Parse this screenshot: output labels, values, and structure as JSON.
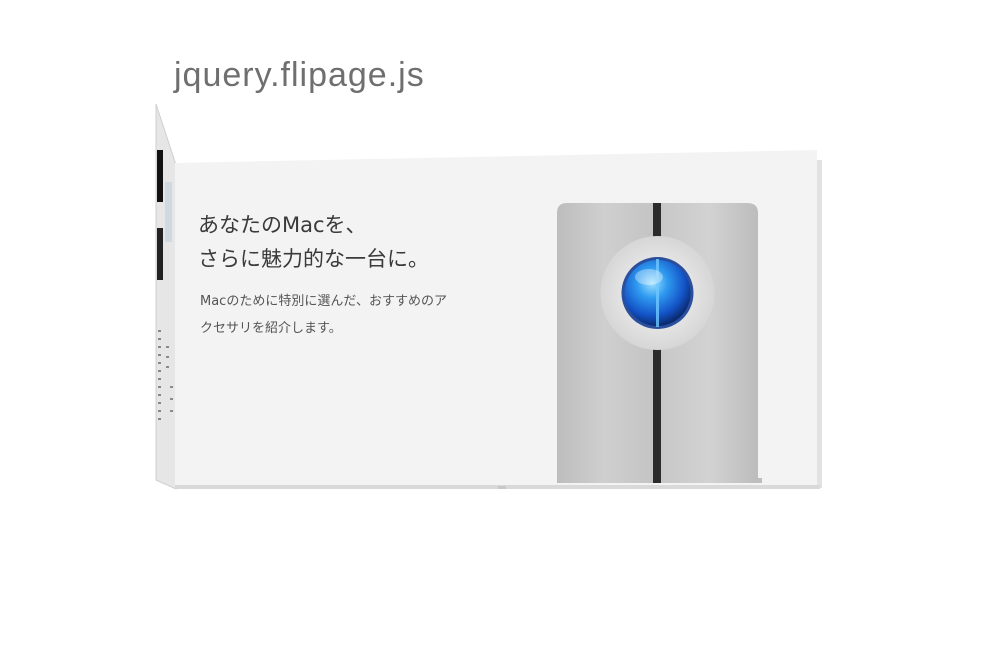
{
  "header": {
    "title": "jquery.flipage.js"
  },
  "page": {
    "headline_line1": "あなたのMacを、",
    "headline_line2": "さらに魅力的な一台に。",
    "sub_line1": "Macのために特別に選んだ、おすすめのア",
    "sub_line2": "クセサリを紹介します。"
  },
  "colors": {
    "page_background": "#f3f3f3",
    "drive_body": "#c9c9c9",
    "drive_light": "#1f7ee8",
    "title_text": "#6f6f6f"
  },
  "icons": {
    "product_image": "external-drive-image"
  }
}
